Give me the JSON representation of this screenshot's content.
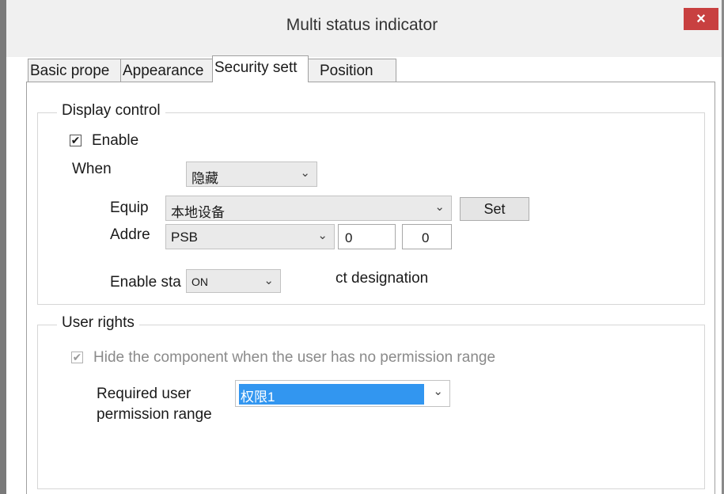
{
  "window": {
    "title": "Multi status indicator",
    "close_glyph": "×"
  },
  "tabs": [
    {
      "label": "Basic prope"
    },
    {
      "label": "Appearance"
    },
    {
      "label": "Security sett"
    },
    {
      "label": "Position"
    }
  ],
  "display_control": {
    "legend": "Display control",
    "enable_label": "Enable",
    "enable_checked": true,
    "when_label": "When",
    "when_value": "隐藏",
    "equip_label": "Equip",
    "equip_value": "本地设备",
    "set_button": "Set",
    "addr_label": "Addre",
    "addr_type": "PSB",
    "addr_value1": "0",
    "addr_value2": "0",
    "enable_state_label": "Enable sta",
    "enable_state_value": "ON",
    "designation_text": "ct designation"
  },
  "user_rights": {
    "legend": "User rights",
    "hide_label": "Hide the component when the user has no permission range",
    "hide_checked": true,
    "required_label_line1": "Required user",
    "required_label_line2": "permission range",
    "permission_value": "权限1"
  },
  "glyphs": {
    "check": "✔",
    "arrow": "⌄"
  }
}
